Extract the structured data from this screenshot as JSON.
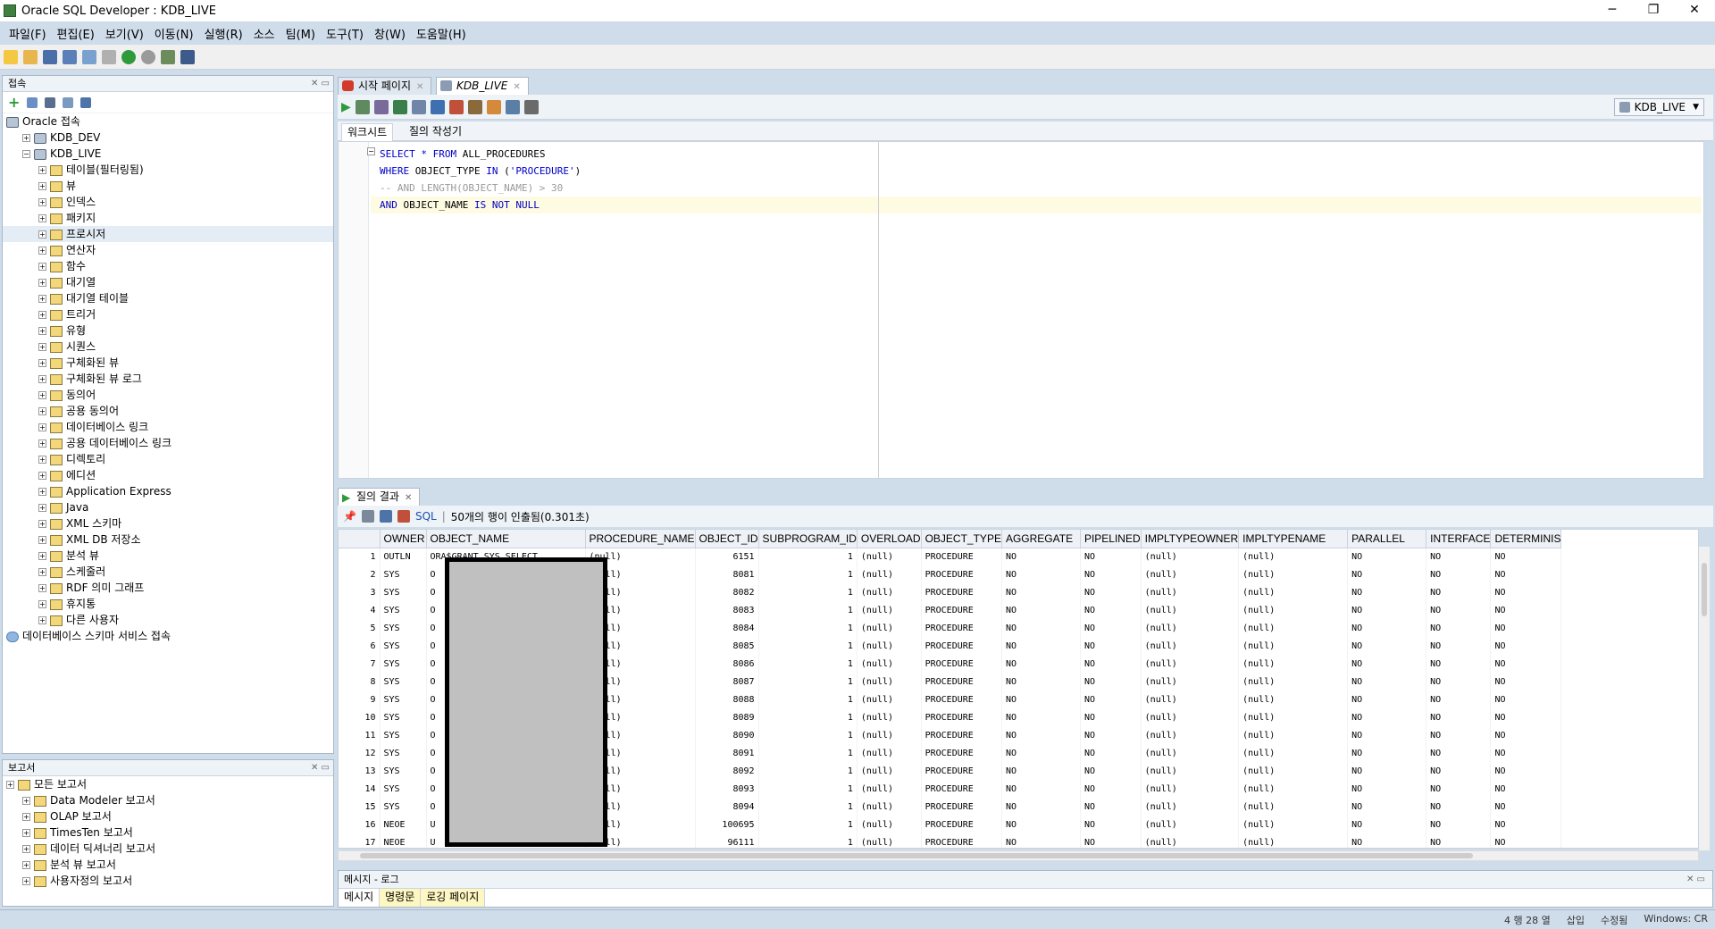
{
  "window": {
    "title": "Oracle SQL Developer : KDB_LIVE",
    "controls": [
      "─",
      "❐",
      "✕"
    ]
  },
  "menu": [
    "파일(F)",
    "편집(E)",
    "보기(V)",
    "이동(N)",
    "실행(R)",
    "소스",
    "팀(M)",
    "도구(T)",
    "창(W)",
    "도움말(H)"
  ],
  "connections_panel": {
    "title": "접속",
    "tree": [
      {
        "label": "Oracle 접속",
        "level": 0,
        "type": "db"
      },
      {
        "label": "KDB_DEV",
        "level": 1,
        "type": "db"
      },
      {
        "label": "KDB_LIVE",
        "level": 1,
        "type": "db"
      },
      {
        "label": "테이블(필터링됨)",
        "level": 2,
        "type": "folder"
      },
      {
        "label": "뷰",
        "level": 2,
        "type": "folder"
      },
      {
        "label": "인덱스",
        "level": 2,
        "type": "folder"
      },
      {
        "label": "패키지",
        "level": 2,
        "type": "folder"
      },
      {
        "label": "프로시저",
        "level": 2,
        "type": "folder",
        "selected": true
      },
      {
        "label": "연산자",
        "level": 2,
        "type": "folder"
      },
      {
        "label": "함수",
        "level": 2,
        "type": "folder"
      },
      {
        "label": "대기열",
        "level": 2,
        "type": "folder"
      },
      {
        "label": "대기열 테이블",
        "level": 2,
        "type": "folder"
      },
      {
        "label": "트리거",
        "level": 2,
        "type": "folder"
      },
      {
        "label": "유형",
        "level": 2,
        "type": "folder"
      },
      {
        "label": "시퀀스",
        "level": 2,
        "type": "folder"
      },
      {
        "label": "구체화된 뷰",
        "level": 2,
        "type": "folder"
      },
      {
        "label": "구체화된 뷰 로그",
        "level": 2,
        "type": "folder"
      },
      {
        "label": "동의어",
        "level": 2,
        "type": "folder"
      },
      {
        "label": "공용 동의어",
        "level": 2,
        "type": "folder"
      },
      {
        "label": "데이터베이스 링크",
        "level": 2,
        "type": "folder"
      },
      {
        "label": "공용 데이터베이스 링크",
        "level": 2,
        "type": "folder"
      },
      {
        "label": "디렉토리",
        "level": 2,
        "type": "folder"
      },
      {
        "label": "에디션",
        "level": 2,
        "type": "folder"
      },
      {
        "label": "Application Express",
        "level": 2,
        "type": "folder"
      },
      {
        "label": "Java",
        "level": 2,
        "type": "folder"
      },
      {
        "label": "XML 스키마",
        "level": 2,
        "type": "folder"
      },
      {
        "label": "XML DB 저장소",
        "level": 2,
        "type": "folder"
      },
      {
        "label": "분석 뷰",
        "level": 2,
        "type": "folder"
      },
      {
        "label": "스케줄러",
        "level": 2,
        "type": "folder"
      },
      {
        "label": "RDF 의미 그래프",
        "level": 2,
        "type": "folder"
      },
      {
        "label": "휴지통",
        "level": 2,
        "type": "folder"
      },
      {
        "label": "다른 사용자",
        "level": 2,
        "type": "folder"
      },
      {
        "label": "데이터베이스 스키마 서비스 접속",
        "level": 0,
        "type": "cloud"
      }
    ]
  },
  "reports_panel": {
    "title": "보고서",
    "tree": [
      {
        "label": "모든 보고서",
        "level": 0
      },
      {
        "label": "Data Modeler 보고서",
        "level": 1
      },
      {
        "label": "OLAP 보고서",
        "level": 1
      },
      {
        "label": "TimesTen 보고서",
        "level": 1
      },
      {
        "label": "데이터 딕셔너리 보고서",
        "level": 1
      },
      {
        "label": "분석 뷰 보고서",
        "level": 1
      },
      {
        "label": "사용자정의 보고서",
        "level": 1
      }
    ]
  },
  "doc_tabs": [
    {
      "label": "시작 페이지"
    },
    {
      "label": "KDB_LIVE",
      "active": true
    }
  ],
  "connection_selector": "KDB_LIVE",
  "sub_tabs": [
    "워크시트",
    "질의 작성기"
  ],
  "sql_lines": [
    [
      {
        "t": "SELECT",
        "c": "kw"
      },
      {
        "t": " ",
        "c": ""
      },
      {
        "t": "*",
        "c": "kw"
      },
      {
        "t": " ",
        "c": ""
      },
      {
        "t": "FROM",
        "c": "kw"
      },
      {
        "t": " ALL_PROCEDURES",
        "c": ""
      }
    ],
    [
      {
        "t": "WHERE",
        "c": "kw"
      },
      {
        "t": " OBJECT_TYPE ",
        "c": ""
      },
      {
        "t": "IN",
        "c": "kw"
      },
      {
        "t": " (",
        "c": ""
      },
      {
        "t": "'PROCEDURE'",
        "c": "str"
      },
      {
        "t": ")",
        "c": ""
      }
    ],
    [
      {
        "t": "-- AND LENGTH(OBJECT_NAME) > 30",
        "c": "cmt"
      }
    ],
    [
      {
        "t": "AND",
        "c": "kw"
      },
      {
        "t": " OBJECT_NAME ",
        "c": ""
      },
      {
        "t": "IS NOT NULL",
        "c": "kw"
      }
    ]
  ],
  "results": {
    "tab_label": "질의 결과",
    "sql_link": "SQL",
    "fetch_status": "50개의 행이 인출됨(0.301초)",
    "columns": [
      "OWNER",
      "OBJECT_NAME",
      "PROCEDURE_NAME",
      "OBJECT_ID",
      "SUBPROGRAM_ID",
      "OVERLOAD",
      "OBJECT_TYPE",
      "AGGREGATE",
      "PIPELINED",
      "IMPLTYPEOWNER",
      "IMPLTYPENAME",
      "PARALLEL",
      "INTERFACE",
      "DETERMINIS"
    ],
    "rows": [
      [
        "1",
        "OUTLN",
        "ORA$GRANT_SYS_SELECT",
        "(null)",
        "6151",
        "1",
        "(null)",
        "PROCEDURE",
        "NO",
        "NO",
        "(null)",
        "(null)",
        "NO",
        "NO",
        "NO"
      ],
      [
        "2",
        "SYS",
        "O",
        "(null)",
        "8081",
        "1",
        "(null)",
        "PROCEDURE",
        "NO",
        "NO",
        "(null)",
        "(null)",
        "NO",
        "NO",
        "NO"
      ],
      [
        "3",
        "SYS",
        "O",
        "(null)",
        "8082",
        "1",
        "(null)",
        "PROCEDURE",
        "NO",
        "NO",
        "(null)",
        "(null)",
        "NO",
        "NO",
        "NO"
      ],
      [
        "4",
        "SYS",
        "O",
        "(null)",
        "8083",
        "1",
        "(null)",
        "PROCEDURE",
        "NO",
        "NO",
        "(null)",
        "(null)",
        "NO",
        "NO",
        "NO"
      ],
      [
        "5",
        "SYS",
        "O",
        "(null)",
        "8084",
        "1",
        "(null)",
        "PROCEDURE",
        "NO",
        "NO",
        "(null)",
        "(null)",
        "NO",
        "NO",
        "NO"
      ],
      [
        "6",
        "SYS",
        "O",
        "(null)",
        "8085",
        "1",
        "(null)",
        "PROCEDURE",
        "NO",
        "NO",
        "(null)",
        "(null)",
        "NO",
        "NO",
        "NO"
      ],
      [
        "7",
        "SYS",
        "O",
        "(null)",
        "8086",
        "1",
        "(null)",
        "PROCEDURE",
        "NO",
        "NO",
        "(null)",
        "(null)",
        "NO",
        "NO",
        "NO"
      ],
      [
        "8",
        "SYS",
        "O",
        "(null)",
        "8087",
        "1",
        "(null)",
        "PROCEDURE",
        "NO",
        "NO",
        "(null)",
        "(null)",
        "NO",
        "NO",
        "NO"
      ],
      [
        "9",
        "SYS",
        "O",
        "(null)",
        "8088",
        "1",
        "(null)",
        "PROCEDURE",
        "NO",
        "NO",
        "(null)",
        "(null)",
        "NO",
        "NO",
        "NO"
      ],
      [
        "10",
        "SYS",
        "O",
        "(null)",
        "8089",
        "1",
        "(null)",
        "PROCEDURE",
        "NO",
        "NO",
        "(null)",
        "(null)",
        "NO",
        "NO",
        "NO"
      ],
      [
        "11",
        "SYS",
        "O",
        "(null)",
        "8090",
        "1",
        "(null)",
        "PROCEDURE",
        "NO",
        "NO",
        "(null)",
        "(null)",
        "NO",
        "NO",
        "NO"
      ],
      [
        "12",
        "SYS",
        "O",
        "(null)",
        "8091",
        "1",
        "(null)",
        "PROCEDURE",
        "NO",
        "NO",
        "(null)",
        "(null)",
        "NO",
        "NO",
        "NO"
      ],
      [
        "13",
        "SYS",
        "O",
        "(null)",
        "8092",
        "1",
        "(null)",
        "PROCEDURE",
        "NO",
        "NO",
        "(null)",
        "(null)",
        "NO",
        "NO",
        "NO"
      ],
      [
        "14",
        "SYS",
        "O",
        "(null)",
        "8093",
        "1",
        "(null)",
        "PROCEDURE",
        "NO",
        "NO",
        "(null)",
        "(null)",
        "NO",
        "NO",
        "NO"
      ],
      [
        "15",
        "SYS",
        "O",
        "(null)",
        "8094",
        "1",
        "(null)",
        "PROCEDURE",
        "NO",
        "NO",
        "(null)",
        "(null)",
        "NO",
        "NO",
        "NO"
      ],
      [
        "16",
        "NEOE",
        "U",
        "(null)",
        "100695",
        "1",
        "(null)",
        "PROCEDURE",
        "NO",
        "NO",
        "(null)",
        "(null)",
        "NO",
        "NO",
        "NO"
      ],
      [
        "17",
        "NEOE",
        "U",
        "(null)",
        "96111",
        "1",
        "(null)",
        "PROCEDURE",
        "NO",
        "NO",
        "(null)",
        "(null)",
        "NO",
        "NO",
        "NO"
      ]
    ]
  },
  "log_panel": {
    "title": "메시지 - 로그",
    "tabs": [
      {
        "label": "메시지"
      },
      {
        "label": "명령문",
        "sel": true
      },
      {
        "label": "로깅 페이지",
        "sel": true
      }
    ]
  },
  "status": {
    "position": "4 행 28 열",
    "mode": "삽입",
    "state": "수정됨",
    "eol": "Windows: CR"
  }
}
